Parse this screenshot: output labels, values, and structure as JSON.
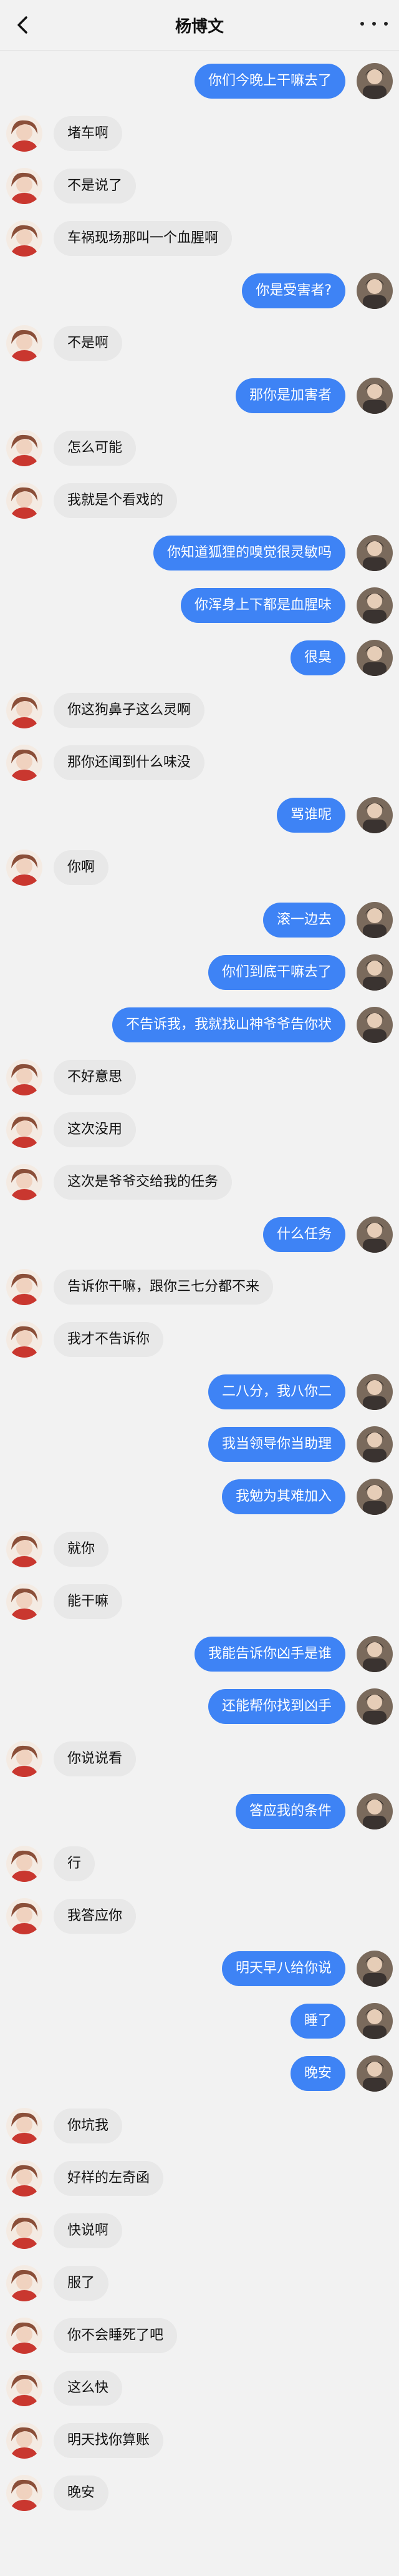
{
  "header": {
    "title": "杨博文"
  },
  "icons": {
    "back": "chevron-left-icon",
    "more": "more-dots-icon"
  },
  "colors": {
    "outgoing_bubble": "#3e83f5",
    "incoming_bubble": "#e8e8e8",
    "background": "#f2f2f2"
  },
  "messages": [
    {
      "side": "right",
      "text": "你们今晚上干嘛去了"
    },
    {
      "side": "left",
      "text": "堵车啊"
    },
    {
      "side": "left",
      "text": "不是说了"
    },
    {
      "side": "left",
      "text": "车祸现场那叫一个血腥啊"
    },
    {
      "side": "right",
      "text": "你是受害者?"
    },
    {
      "side": "left",
      "text": "不是啊"
    },
    {
      "side": "right",
      "text": "那你是加害者"
    },
    {
      "side": "left",
      "text": "怎么可能"
    },
    {
      "side": "left",
      "text": "我就是个看戏的"
    },
    {
      "side": "right",
      "text": "你知道狐狸的嗅觉很灵敏吗"
    },
    {
      "side": "right",
      "text": "你浑身上下都是血腥味"
    },
    {
      "side": "right",
      "text": "很臭"
    },
    {
      "side": "left",
      "text": "你这狗鼻子这么灵啊"
    },
    {
      "side": "left",
      "text": "那你还闻到什么味没"
    },
    {
      "side": "right",
      "text": "骂谁呢"
    },
    {
      "side": "left",
      "text": "你啊"
    },
    {
      "side": "right",
      "text": "滚一边去"
    },
    {
      "side": "right",
      "text": "你们到底干嘛去了"
    },
    {
      "side": "right",
      "text": "不告诉我，我就找山神爷爷告你状"
    },
    {
      "side": "left",
      "text": "不好意思"
    },
    {
      "side": "left",
      "text": "这次没用"
    },
    {
      "side": "left",
      "text": "这次是爷爷交给我的任务"
    },
    {
      "side": "right",
      "text": "什么任务"
    },
    {
      "side": "left",
      "text": "告诉你干嘛，跟你三七分都不来"
    },
    {
      "side": "left",
      "text": "我才不告诉你"
    },
    {
      "side": "right",
      "text": "二八分，我八你二"
    },
    {
      "side": "right",
      "text": "我当领导你当助理"
    },
    {
      "side": "right",
      "text": "我勉为其难加入"
    },
    {
      "side": "left",
      "text": "就你"
    },
    {
      "side": "left",
      "text": "能干嘛"
    },
    {
      "side": "right",
      "text": "我能告诉你凶手是谁"
    },
    {
      "side": "right",
      "text": "还能帮你找到凶手"
    },
    {
      "side": "left",
      "text": "你说说看"
    },
    {
      "side": "right",
      "text": "答应我的条件"
    },
    {
      "side": "left",
      "text": "行"
    },
    {
      "side": "left",
      "text": "我答应你"
    },
    {
      "side": "right",
      "text": "明天早八给你说"
    },
    {
      "side": "right",
      "text": "睡了"
    },
    {
      "side": "right",
      "text": "晚安"
    },
    {
      "side": "left",
      "text": "你坑我"
    },
    {
      "side": "left",
      "text": "好样的左奇函"
    },
    {
      "side": "left",
      "text": "快说啊"
    },
    {
      "side": "left",
      "text": "服了"
    },
    {
      "side": "left",
      "text": "你不会睡死了吧"
    },
    {
      "side": "left",
      "text": "这么快"
    },
    {
      "side": "left",
      "text": "明天找你算账"
    },
    {
      "side": "left",
      "text": "晚安"
    }
  ]
}
